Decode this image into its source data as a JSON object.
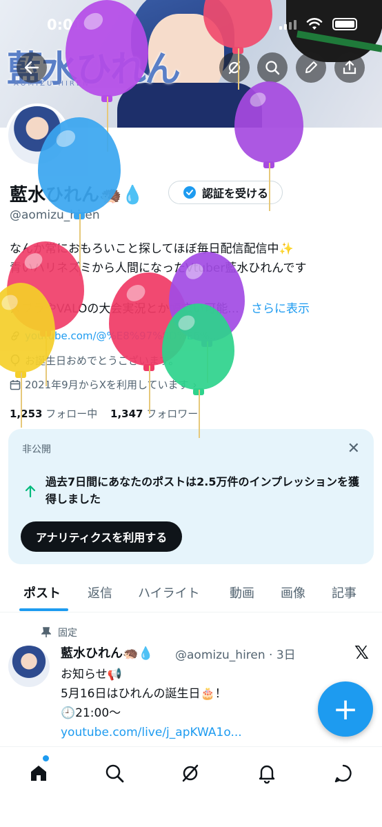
{
  "status_bar": {
    "time": "0:01"
  },
  "banner": {
    "logo": "藍水ひれん",
    "logo_sub": "AOMIZU HIREN"
  },
  "profile": {
    "name": "藍水ひれん🦔💧",
    "verify_button": "認証を受ける",
    "handle": "@aomizu_hiren",
    "bio_line1": "なんか常におもろいこと探してほぼ毎日配信配信中✨",
    "bio_line2": "青いハリネズミから人間になったVtuber藍水ひれんです",
    "bio_line3": "スプラやVALOの大会実況とか幅広い可能...",
    "show_more": "さらに表示",
    "link": "youtube.com/@%E8%97%8D%E6%...",
    "birthday": "お誕生日おめでとうございます。",
    "joined": "2021年9月からXを利用しています",
    "following_count": "1,253",
    "following_label": "フォロー中",
    "followers_count": "1,347",
    "followers_label": "フォロワー"
  },
  "analytics_card": {
    "label": "非公開",
    "message": "過去7日間にあなたのポストは2.5万件のインプレッションを獲得しました",
    "cta": "アナリティクスを利用する"
  },
  "tabs": [
    "ポスト",
    "返信",
    "ハイライト",
    "動画",
    "画像",
    "記事"
  ],
  "pinned_post": {
    "pinned_label": "固定",
    "name": "藍水ひれん🦔💧",
    "handle_time": "@aomizu_hiren · 3日",
    "line1": "お知らせ📢",
    "line2": "5月16日はひれんの誕生日🎂！",
    "line3": "🕘21:00〜",
    "link": "youtube.com/live/j_apKWA1o..."
  },
  "fab_label": "+",
  "colors": {
    "accent": "#1d9bf0",
    "text": "#0f1419",
    "muted": "#536471",
    "card_bg": "#e6f4fb"
  },
  "icons": [
    "back-arrow-icon",
    "grok-icon",
    "search-icon",
    "edit-icon",
    "share-icon",
    "verified-check-icon",
    "link-icon",
    "balloon-icon",
    "calendar-icon",
    "pin-icon",
    "home-icon",
    "notifications-icon",
    "messages-icon"
  ]
}
